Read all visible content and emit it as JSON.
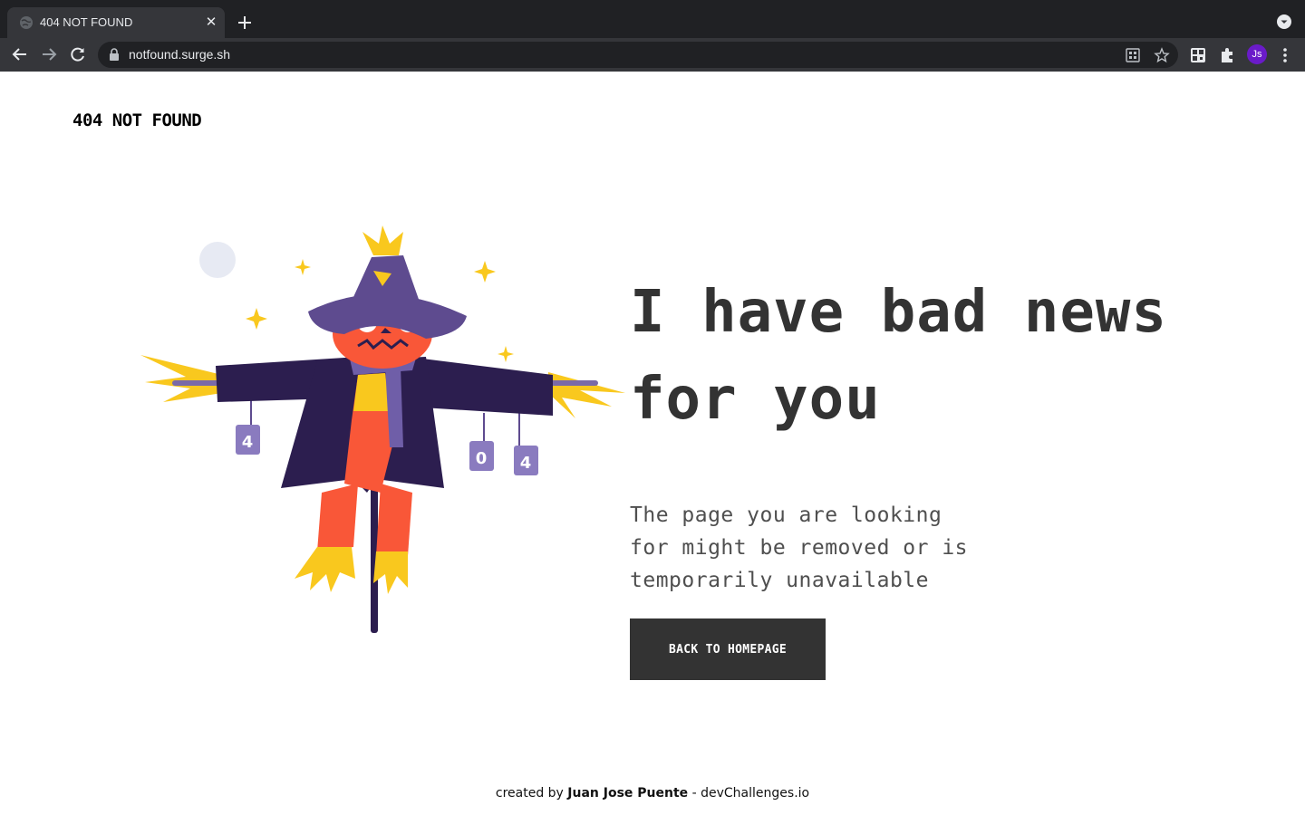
{
  "browser": {
    "tab_title": "404 NOT FOUND",
    "url": "notfound.surge.sh",
    "profile_initials": "Js"
  },
  "page": {
    "logo": "404 NOT FOUND",
    "headline_line1": "I have bad news",
    "headline_line2": "for you",
    "subtext_line1": "The page you are looking",
    "subtext_line2": "for might be removed or is",
    "subtext_line3": "temporarily unavailable",
    "button_label": "BACK TO HOMEPAGE",
    "illustration": {
      "can_left_label": "4",
      "can_middle_label": "0",
      "can_right_label": "4"
    }
  },
  "footer": {
    "prefix": "created by",
    "author": "Juan Jose Puente",
    "separator": "-",
    "site": "devChallenges.io"
  },
  "colors": {
    "headline": "#333333",
    "button_bg": "#333333",
    "hat": "#5e4b8f",
    "coat": "#2c1e4f",
    "face": "#f95738",
    "straw": "#f9c81e"
  }
}
